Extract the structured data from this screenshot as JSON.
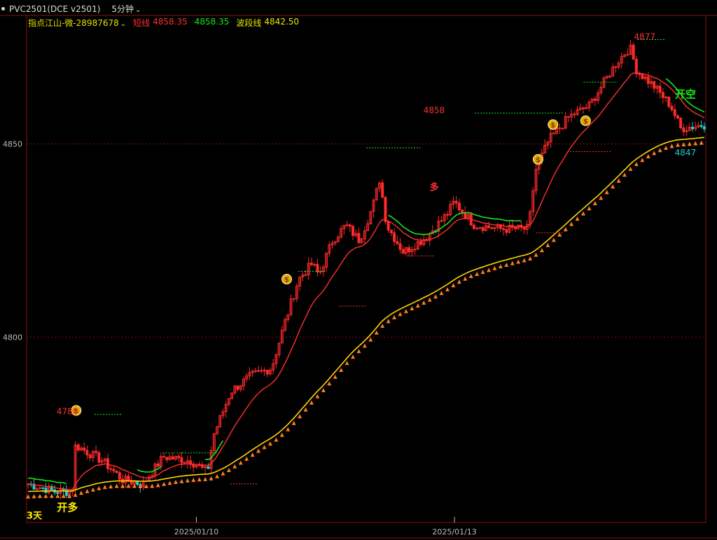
{
  "header": {
    "symbol": "PVC2501(DCE v2501)",
    "period": "5分钟"
  },
  "indicator": {
    "name": "指点江山-微-28987678",
    "short_label": "短线",
    "short_value": "4858.35",
    "mid_value": "4858.35",
    "wave_label": "波段线",
    "wave_value": "4842.50",
    "colors": {
      "name": "#e8e800",
      "short": "#ff3030",
      "mid": "#19e619",
      "wave": "#e8e800"
    }
  },
  "chart_data": {
    "type": "candlestick",
    "ylim": [
      4752,
      4880
    ],
    "y_ticks": [
      4800,
      4850
    ],
    "x_labels": [
      {
        "label": "2025/01/10",
        "pos": 0.25
      },
      {
        "label": "2025/01/13",
        "pos": 0.63
      }
    ],
    "price_annotations": [
      {
        "text": "4780",
        "price": 4780,
        "pos": 0.06,
        "color": "#ff3030"
      },
      {
        "text": "4858",
        "price": 4858,
        "pos": 0.6,
        "color": "#ff3030"
      },
      {
        "text": "4877",
        "price": 4877,
        "pos": 0.91,
        "color": "#ff3030"
      },
      {
        "text": "4847",
        "price": 4847,
        "pos": 0.97,
        "color": "#22cccc"
      }
    ],
    "signals": [
      {
        "text": "开多",
        "pos": 0.06,
        "price": 4755,
        "color": "#ffee00"
      },
      {
        "text": "3天",
        "pos": 0.0,
        "price": 4753,
        "color": "#ffee00"
      },
      {
        "text": "多",
        "pos": 0.6,
        "price": 4838,
        "color": "#ff3030"
      },
      {
        "text": "开空",
        "pos": 0.97,
        "price": 4862,
        "color": "#19e619"
      }
    ],
    "series": [
      {
        "name": "短线",
        "color": "#ff3030"
      },
      {
        "name": "波段线",
        "color": "#e8e800"
      }
    ],
    "keypoints": [
      [
        0,
        4762
      ],
      [
        0.04,
        4760
      ],
      [
        0.065,
        4760
      ],
      [
        0.07,
        4772
      ],
      [
        0.09,
        4770
      ],
      [
        0.11,
        4768
      ],
      [
        0.14,
        4763
      ],
      [
        0.17,
        4762
      ],
      [
        0.2,
        4769
      ],
      [
        0.24,
        4768
      ],
      [
        0.265,
        4765
      ],
      [
        0.275,
        4775
      ],
      [
        0.3,
        4786
      ],
      [
        0.33,
        4790
      ],
      [
        0.36,
        4792
      ],
      [
        0.38,
        4804
      ],
      [
        0.4,
        4815
      ],
      [
        0.42,
        4819
      ],
      [
        0.43,
        4816
      ],
      [
        0.45,
        4825
      ],
      [
        0.47,
        4829
      ],
      [
        0.49,
        4825
      ],
      [
        0.51,
        4834
      ],
      [
        0.52,
        4841
      ],
      [
        0.53,
        4829
      ],
      [
        0.555,
        4822
      ],
      [
        0.59,
        4826
      ],
      [
        0.62,
        4832
      ],
      [
        0.63,
        4835
      ],
      [
        0.66,
        4829
      ],
      [
        0.7,
        4828
      ],
      [
        0.74,
        4828
      ],
      [
        0.75,
        4843
      ],
      [
        0.77,
        4851
      ],
      [
        0.8,
        4857
      ],
      [
        0.83,
        4860
      ],
      [
        0.87,
        4871
      ],
      [
        0.89,
        4875
      ],
      [
        0.9,
        4869
      ],
      [
        0.925,
        4865
      ],
      [
        0.95,
        4860
      ],
      [
        0.965,
        4854
      ],
      [
        1.0,
        4855
      ]
    ]
  }
}
